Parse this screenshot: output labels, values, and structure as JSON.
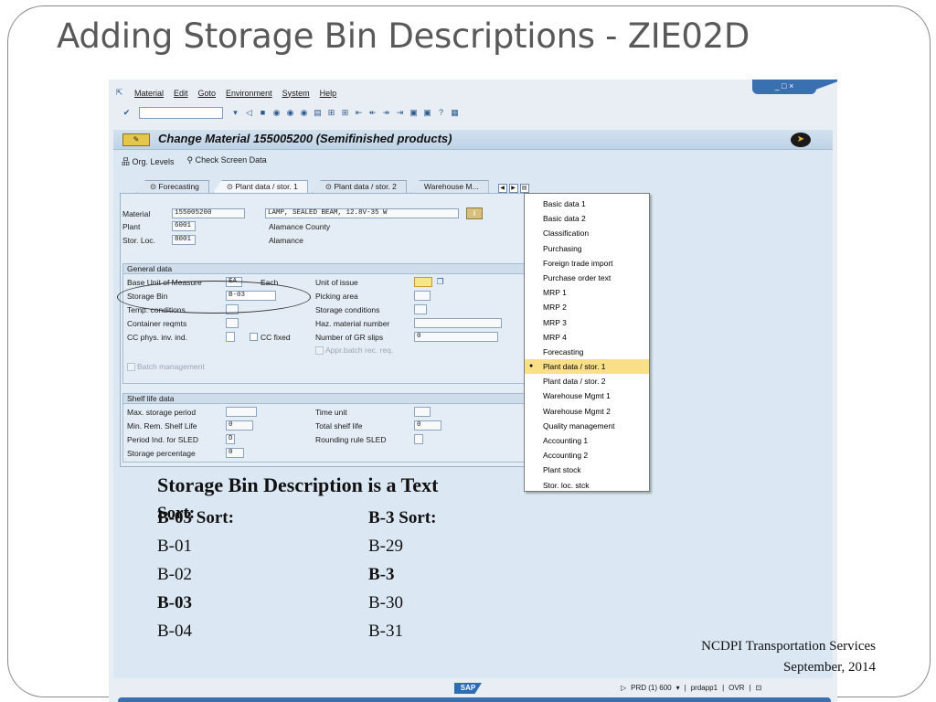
{
  "slide_title": "Adding Storage Bin Descriptions - ZIE02D",
  "menu": [
    "Material",
    "Edit",
    "Goto",
    "Environment",
    "System",
    "Help"
  ],
  "window_controls": "_ □ ×",
  "screen": {
    "badge": "✎ ",
    "title": "Change Material 155005200 (Semifinished products)"
  },
  "app_toolbar": [
    "Org. Levels",
    "Check Screen Data"
  ],
  "tabs": [
    "Forecasting",
    "Plant data / stor. 1",
    "Plant data / stor. 2",
    "Warehouse M..."
  ],
  "header_fields": {
    "material_label": "Material",
    "material_value": "155005200",
    "material_desc": "LAMP, SEALED BEAM, 12.8V-35 W",
    "plant_label": "Plant",
    "plant_value": "6001",
    "plant_desc": "Alamance County",
    "stor_label": "Stor. Loc.",
    "stor_value": "8001",
    "stor_desc": "Alamance"
  },
  "general_data": {
    "title": "General data",
    "base_uom_label": "Base Unit of Measure",
    "base_uom_value": "EA",
    "base_uom_desc": "Each",
    "storage_bin_label": "Storage Bin",
    "storage_bin_value": "B-03",
    "temp_cond_label": "Temp. conditions",
    "container_label": "Container reqmts",
    "cc_phys_label": "CC phys. inv. ind.",
    "cc_fixed_label": "CC fixed",
    "batch_mgmt_label": "Batch management",
    "unit_issue_label": "Unit of issue",
    "picking_label": "Picking area",
    "storage_cond_label": "Storage conditions",
    "haz_label": "Haz. material number",
    "gr_slips_label": "Number of GR slips",
    "gr_slips_value": "0",
    "appr_batch_label": "Appr.batch rec. req."
  },
  "shelf_life": {
    "title": "Shelf life data",
    "max_storage_label": "Max. storage period",
    "min_rem_label": "Min. Rem. Shelf Life",
    "min_rem_value": "0",
    "period_ind_label": "Period Ind. for SLED",
    "period_ind_value": "D",
    "storage_pct_label": "Storage percentage",
    "storage_pct_value": "0",
    "time_unit_label": "Time unit",
    "total_shelf_label": "Total shelf life",
    "total_shelf_value": "0",
    "rounding_label": "Rounding rule SLED"
  },
  "dropdown_items": [
    "Basic data 1",
    "Basic data 2",
    "Classification",
    "Purchasing",
    "Foreign trade import",
    "Purchase order text",
    "MRP 1",
    "MRP 2",
    "MRP 3",
    "MRP 4",
    "Forecasting",
    "Plant data / stor. 1",
    "Plant data / stor. 2",
    "Warehouse Mgmt 1",
    "Warehouse Mgmt 2",
    "Quality management",
    "Accounting 1",
    "Accounting 2",
    "Plant stock",
    "Stor. loc. stck"
  ],
  "overlay": {
    "heading": "Storage Bin Description is a Text",
    "heading_overlap": "Sort:",
    "left_header": "B-03 Sort:",
    "right_header": "B-3 Sort:",
    "left_list": [
      "B-01",
      "B-02",
      "B-03",
      "B-04"
    ],
    "right_list": [
      "B-29",
      "B-3",
      "B-30",
      "B-31"
    ]
  },
  "footer": {
    "org": "NCDPI Transportation Services",
    "date": "September, 2014"
  },
  "status": {
    "system": "PRD (1) 600",
    "server": "prdapp1",
    "mode": "OVR",
    "sap_mark": "SAP"
  }
}
